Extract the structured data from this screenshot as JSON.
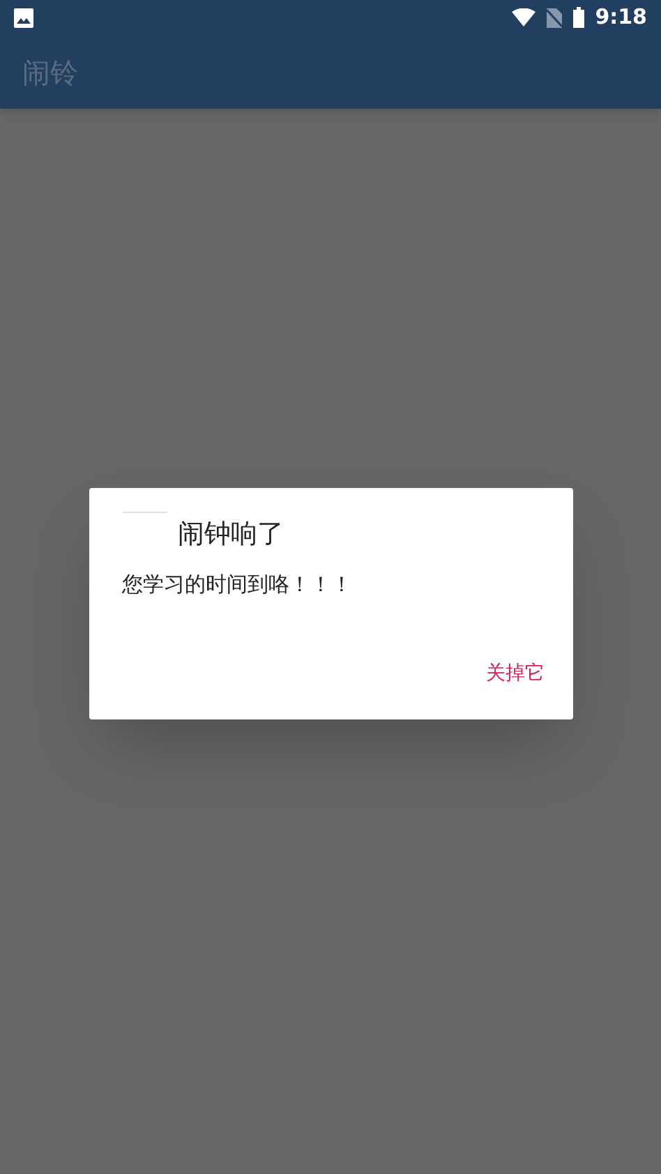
{
  "status_bar": {
    "time": "9:18"
  },
  "app_bar": {
    "title": "闹铃"
  },
  "dialog": {
    "title": "闹钟响了",
    "message": "您学习的时间到咯！！！",
    "buttons": [
      "关掉它"
    ]
  }
}
